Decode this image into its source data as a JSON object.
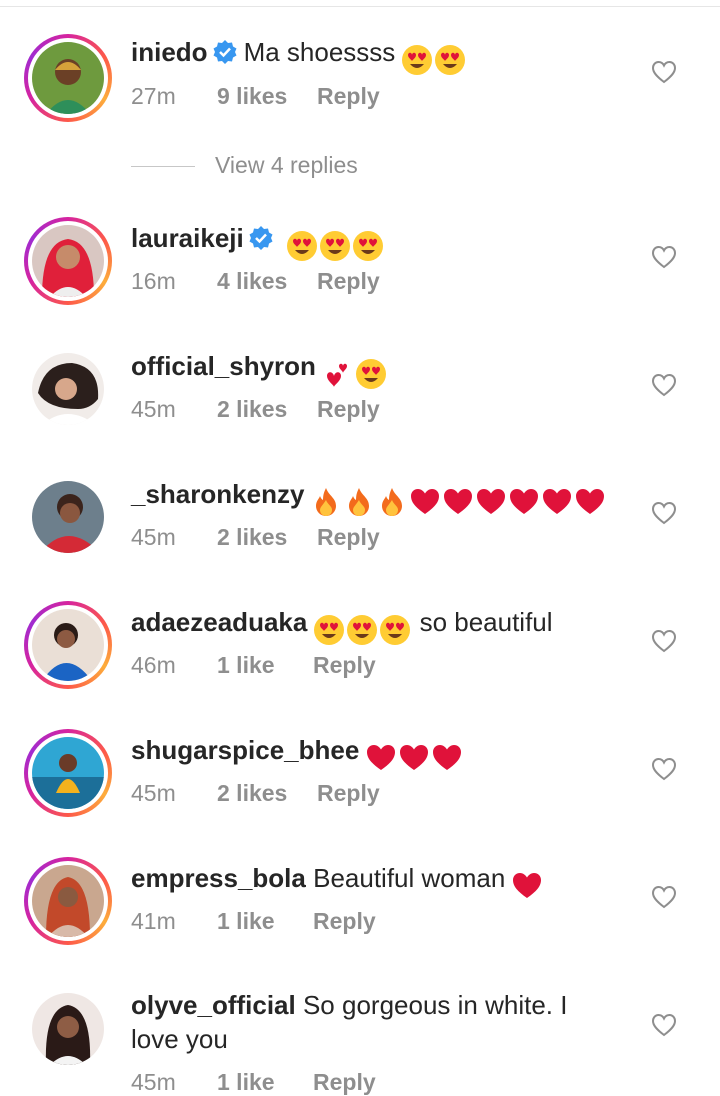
{
  "comments": [
    {
      "username": "iniedo",
      "verified": true,
      "text": "Ma shoessss",
      "time": "27m",
      "likes": "9 likes",
      "reply": "Reply"
    },
    {
      "username": "lauraikeji",
      "verified": true,
      "text": "",
      "time": "16m",
      "likes": "4 likes",
      "reply": "Reply"
    },
    {
      "username": "official_shyron",
      "verified": false,
      "text": "",
      "time": "45m",
      "likes": "2 likes",
      "reply": "Reply"
    },
    {
      "username": "_sharonkenzy",
      "verified": false,
      "text": "",
      "time": "45m",
      "likes": "2 likes",
      "reply": "Reply"
    },
    {
      "username": "adaezeaduaka",
      "verified": false,
      "text": "so beautiful",
      "time": "46m",
      "likes": "1 like",
      "reply": "Reply"
    },
    {
      "username": "shugarspice_bhee",
      "verified": false,
      "text": "",
      "time": "45m",
      "likes": "2 likes",
      "reply": "Reply"
    },
    {
      "username": "empress_bola",
      "verified": false,
      "text": "Beautiful woman",
      "time": "41m",
      "likes": "1 like",
      "reply": "Reply"
    },
    {
      "username": "olyve_official",
      "verified": false,
      "text": "So gorgeous in white. I love you",
      "time": "45m",
      "likes": "1 like",
      "reply": "Reply"
    }
  ],
  "view_replies": "View 4 replies",
  "icons": {
    "like": "heart-outline-icon",
    "verified": "verified-badge-icon"
  },
  "colors": {
    "meta": "#8e8e8e",
    "verified": "#3897f0",
    "heart_emoji": "#e0123a"
  }
}
